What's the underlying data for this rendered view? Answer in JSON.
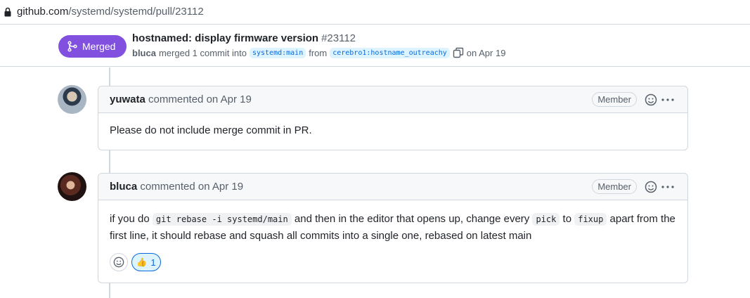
{
  "browser": {
    "url_host": "github.com",
    "url_path": "/systemd/systemd/pull/23112"
  },
  "pr": {
    "status": "Merged",
    "title": "hostnamed: display firmware version",
    "number": "#23112",
    "author": "bluca",
    "merged_text": "merged 1 commit into",
    "base_branch": "systemd:main",
    "from_text": "from",
    "head_branch": "cerebro1:hostname_outreachy",
    "date_text": "on Apr 19"
  },
  "comments": [
    {
      "author": "yuwata",
      "meta": "commented on Apr 19",
      "role": "Member",
      "body": "Please do not include merge commit in PR."
    },
    {
      "author": "bluca",
      "meta": "commented on Apr 19",
      "role": "Member",
      "body_parts": {
        "t1": "if you do ",
        "c1": "git rebase -i systemd/main",
        "t2": " and then in the editor that opens up, change every ",
        "c2": "pick",
        "t3": " to ",
        "c3": "fixup",
        "t4": " apart from the first line, it should rebase and squash all commits into a single one, rebased on latest main"
      },
      "reactions": [
        {
          "icon": "thumbs-up",
          "count": "1"
        }
      ]
    }
  ],
  "colors": {
    "merged": "#8250df",
    "link": "#0969da",
    "border": "#d0d7de"
  }
}
